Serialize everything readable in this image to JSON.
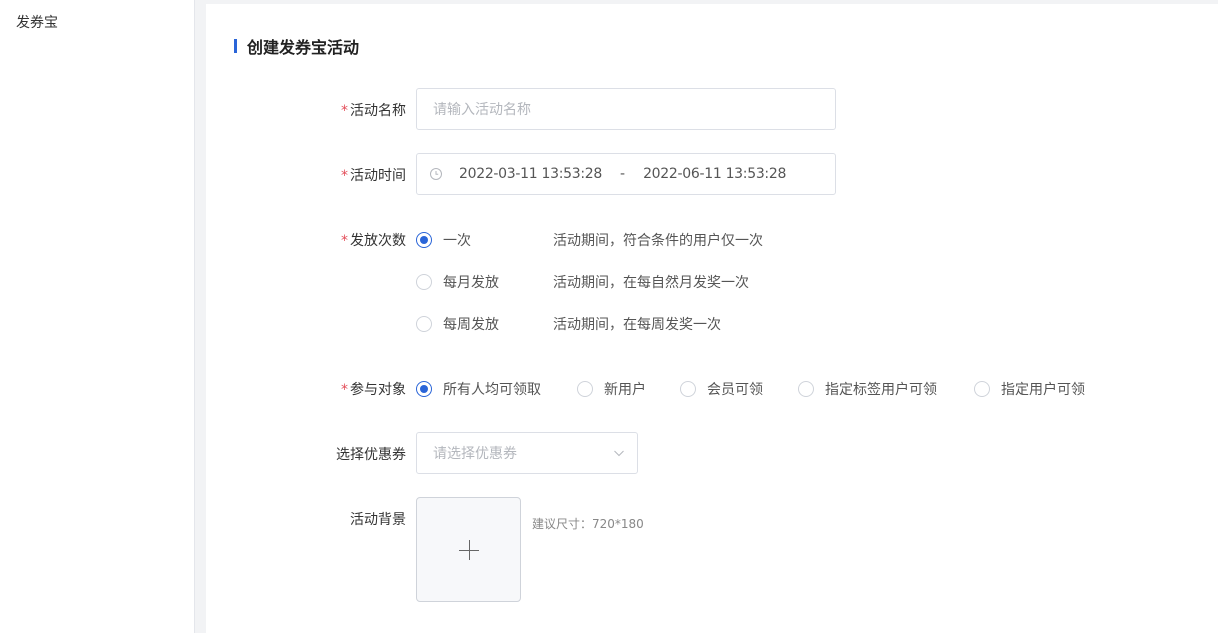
{
  "sidebar": {
    "items": [
      {
        "label": "发券宝"
      }
    ]
  },
  "page": {
    "title": "创建发券宝活动"
  },
  "form": {
    "required_mark": "*",
    "name": {
      "label": "活动名称",
      "placeholder": "请输入活动名称"
    },
    "time": {
      "label": "活动时间",
      "start": "2022-03-11 13:53:28",
      "separator": "-",
      "end": "2022-06-11 13:53:28"
    },
    "frequency": {
      "label": "发放次数",
      "options": [
        {
          "label": "一次",
          "desc": "活动期间，符合条件的用户仅一次",
          "checked": true
        },
        {
          "label": "每月发放",
          "desc": "活动期间，在每自然月发奖一次",
          "checked": false
        },
        {
          "label": "每周发放",
          "desc": "活动期间，在每周发奖一次",
          "checked": false
        }
      ]
    },
    "audience": {
      "label": "参与对象",
      "options": [
        {
          "label": "所有人均可领取",
          "checked": true
        },
        {
          "label": "新用户",
          "checked": false
        },
        {
          "label": "会员可领",
          "checked": false
        },
        {
          "label": "指定标签用户可领",
          "checked": false
        },
        {
          "label": "指定用户可领",
          "checked": false
        }
      ]
    },
    "coupon": {
      "label": "选择优惠券",
      "placeholder": "请选择优惠券"
    },
    "background": {
      "label": "活动背景",
      "hint": "建议尺寸：720*180"
    }
  },
  "colors": {
    "accent": "#2a65d8",
    "required": "#e34d59"
  },
  "icons": {
    "clock": "clock-icon",
    "chevron": "chevron-down-icon",
    "plus": "plus-icon"
  }
}
